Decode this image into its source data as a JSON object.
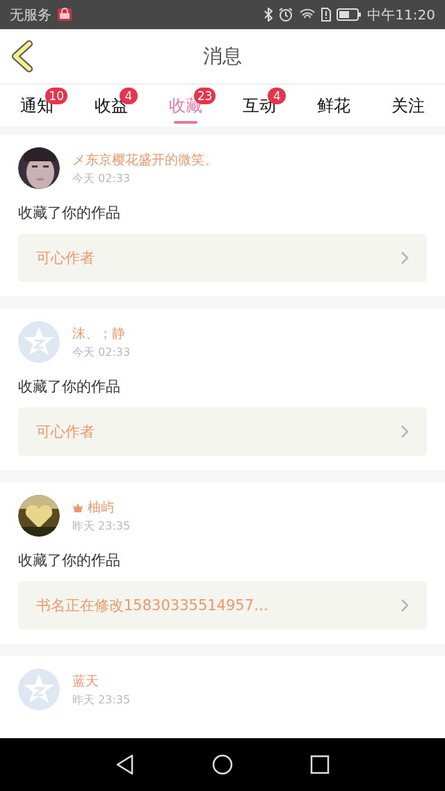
{
  "status_bar": {
    "carrier": "无服务",
    "time": "中午11:20"
  },
  "header": {
    "title": "消息"
  },
  "tabs": [
    {
      "label": "通知",
      "badge": "10",
      "selected": false
    },
    {
      "label": "收益",
      "badge": "4",
      "selected": false
    },
    {
      "label": "收藏",
      "badge": "23",
      "selected": true
    },
    {
      "label": "互动",
      "badge": "4",
      "selected": false
    },
    {
      "label": "鲜花",
      "selected": false
    },
    {
      "label": "关注",
      "selected": false
    }
  ],
  "messages": [
    {
      "kind": "picture",
      "name": "メ东京樱花盛开的微笑、",
      "crown": false,
      "time": "今天 02:33",
      "text": "收藏了你的作品",
      "book": "可心作者"
    },
    {
      "kind": "default",
      "name": "沫、；静",
      "crown": false,
      "time": "今天 02:33",
      "text": "收藏了你的作品",
      "book": "可心作者"
    },
    {
      "kind": "picture",
      "name": "柚屿",
      "crown": true,
      "time": "昨天 23:35",
      "text": "收藏了你的作品",
      "book": "书名正在修改15830335514957…"
    },
    {
      "kind": "default",
      "name": "蓝天",
      "crown": false,
      "time": "昨天 23:35"
    }
  ]
}
